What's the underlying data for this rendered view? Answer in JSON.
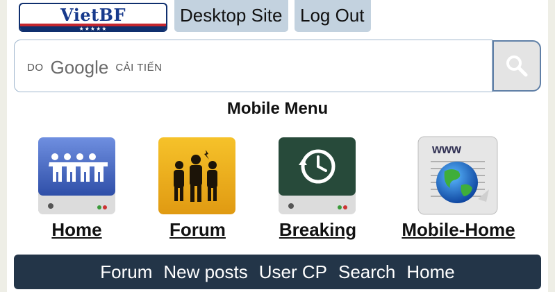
{
  "header": {
    "logo_text": "VietBF",
    "logo_stars": "★★★★★",
    "desktop_site_label": "Desktop Site",
    "logout_label": "Log Out"
  },
  "search": {
    "brand_prefix": "DO",
    "brand_name": "Google",
    "brand_suffix": "CẢI TIẾN",
    "button_icon": "search-icon"
  },
  "menu": {
    "title": "Mobile Menu",
    "items": [
      {
        "label": "Home",
        "icon": "people-chain-icon"
      },
      {
        "label": "Forum",
        "icon": "group-people-icon"
      },
      {
        "label": "Breaking",
        "icon": "history-clock-icon"
      },
      {
        "label": "Mobile-Home",
        "icon": "www-globe-icon"
      }
    ]
  },
  "navbar": {
    "items": [
      "Forum",
      "New posts",
      "User CP",
      "Search",
      "Home"
    ]
  },
  "colors": {
    "top_button_bg": "#c3d2df",
    "navbar_bg": "#233548",
    "search_border": "#9fb6cd",
    "page_bg": "#eeeee6"
  }
}
